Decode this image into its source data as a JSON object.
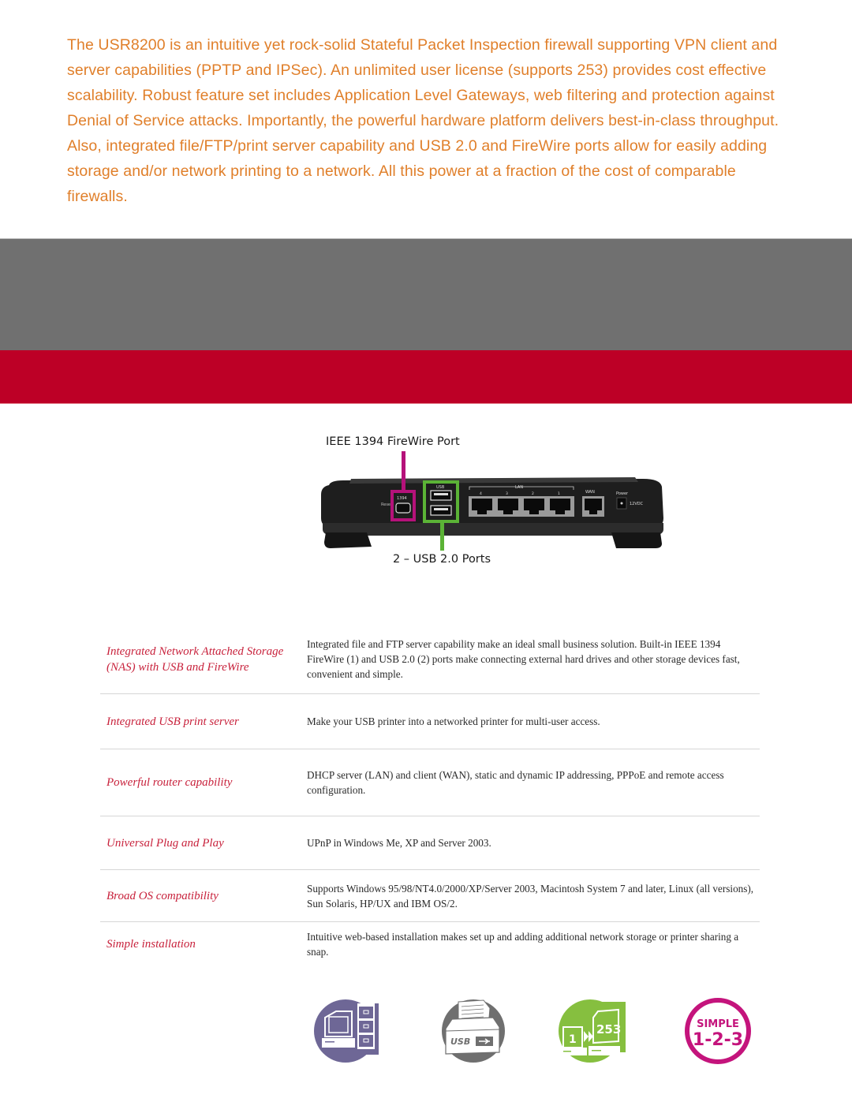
{
  "intro": {
    "text": "The USR8200 is an intuitive yet rock-solid Stateful Packet Inspection firewall supporting VPN client and server capabilities (PPTP and IPSec). An unlimited user license (supports 253) provides cost effective scalability. Robust feature set includes  Application Level Gateways, web filtering and protection against Denial of Service attacks. Importantly, the powerful hardware platform delivers best-in-class throughput. Also, integrated file/FTP/print server capability and USB 2.0 and FireWire ports allow for easily adding storage and/or network printing to a network. All this power at a fraction of the cost of comparable firewalls."
  },
  "colors": {
    "intro_text": "#e07f2a",
    "gray_band": "#707070",
    "red_band": "#bd0026",
    "feature_name": "#c8223c",
    "firewire_callout": "#b5127a",
    "usb_callout": "#5bb336",
    "icon_purple": "#6e6796",
    "icon_gray": "#6f6f6f",
    "icon_green": "#86bf3f",
    "icon_magenta": "#c4147c"
  },
  "diagram": {
    "firewire_label": "IEEE 1394 FireWire Port",
    "usb_label": "2 – USB 2.0 Ports",
    "router_labels": {
      "reset": "Reset",
      "firewire": "1394",
      "usb": "USB",
      "lan": "LAN",
      "lan_ports": [
        "4",
        "3",
        "2",
        "1"
      ],
      "wan": "WAN",
      "power": "Power",
      "voltage": "12VDC"
    }
  },
  "features": [
    {
      "name": "Integrated Network Attached  Storage (NAS) with USB and FireWire",
      "description": "Integrated file and FTP server capability make an ideal small business solution. Built-in IEEE 1394 FireWire (1) and USB 2.0 (2) ports make connecting external hard drives and other storage devices fast, convenient and simple."
    },
    {
      "name": "Integrated USB print server",
      "description": "Make your USB printer into a networked printer for multi-user access."
    },
    {
      "name": "Powerful router capability",
      "description": "DHCP server (LAN) and client (WAN), static and dynamic IP addressing, PPPoE and remote access configuration."
    },
    {
      "name": "Universal Plug and Play",
      "description": "UPnP in Windows Me, XP and Server 2003."
    },
    {
      "name": "Broad OS compatibility",
      "description": "Supports Windows 95/98/NT4.0/2000/XP/Server 2003, Macintosh System 7 and later, Linux (all versions), Sun Solaris, HP/UX and IBM OS/2."
    },
    {
      "name": "Simple installation",
      "description": "Intuitive web-based installation makes set up and adding additional network storage or printer sharing a snap."
    }
  ],
  "icons": [
    {
      "name": "nas-storage-icon"
    },
    {
      "name": "usb-printer-icon",
      "label": "USB"
    },
    {
      "name": "user-license-icon",
      "from": "1",
      "to": "253"
    },
    {
      "name": "simple-setup-icon",
      "line1": "SIMPLE",
      "line2": "1-2-3"
    }
  ]
}
